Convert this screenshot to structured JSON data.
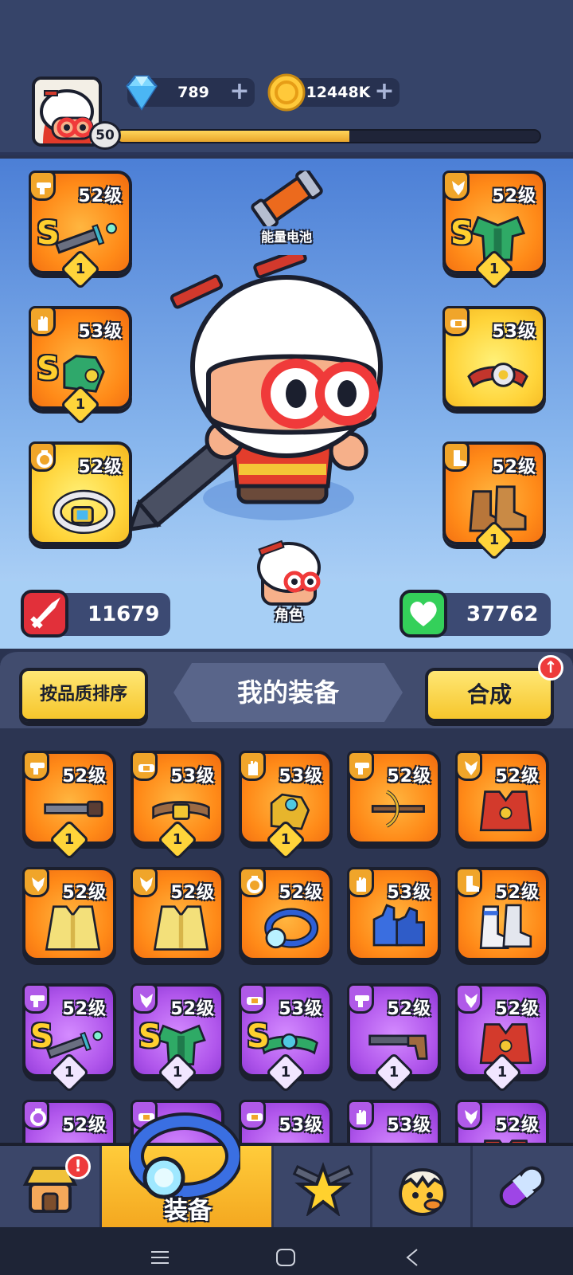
{
  "header": {
    "player_level": "50",
    "xp_progress": 0.55,
    "gems": "789",
    "coins": "12448K",
    "plus": "+"
  },
  "hero": {
    "energy_battery_label": "能量电池",
    "character_label": "角色",
    "attack": "11679",
    "health": "37762"
  },
  "equipped": [
    {
      "slot": "weapon",
      "level": "52级",
      "rarity": "orange",
      "type_icon": "gun-icon",
      "item_icon": "dagger-icon",
      "grade": "S",
      "count": "1"
    },
    {
      "slot": "gloves",
      "level": "53级",
      "rarity": "orange",
      "type_icon": "glove-icon",
      "item_icon": "green-gauntlet-icon",
      "grade": "S",
      "count": "1"
    },
    {
      "slot": "ring",
      "level": "52级",
      "rarity": "yellow",
      "type_icon": "ring-icon",
      "item_icon": "blue-gem-ring-icon",
      "grade": "",
      "count": ""
    },
    {
      "slot": "armor",
      "level": "52级",
      "rarity": "orange",
      "type_icon": "tie-icon",
      "item_icon": "green-armor-icon",
      "grade": "S",
      "count": "1"
    },
    {
      "slot": "belt",
      "level": "53级",
      "rarity": "yellow",
      "type_icon": "belt-icon",
      "item_icon": "eye-belt-icon",
      "grade": "",
      "count": ""
    },
    {
      "slot": "boots",
      "level": "52级",
      "rarity": "orange",
      "type_icon": "boot-icon",
      "item_icon": "brown-boots-icon",
      "grade": "",
      "count": "1"
    }
  ],
  "panel": {
    "sort_button": "按品质排序",
    "title": "我的装备",
    "merge_button": "合成",
    "merge_badge": "↑"
  },
  "inventory": [
    {
      "level": "52级",
      "rarity": "orange",
      "type_icon": "gun-icon",
      "item_icon": "knife-icon",
      "grade": "",
      "count": "1"
    },
    {
      "level": "53级",
      "rarity": "orange",
      "type_icon": "belt-icon",
      "item_icon": "leather-belt-icon",
      "grade": "",
      "count": "1"
    },
    {
      "level": "53级",
      "rarity": "orange",
      "type_icon": "glove-icon",
      "item_icon": "gold-gauntlet-icon",
      "grade": "",
      "count": "1"
    },
    {
      "level": "52级",
      "rarity": "orange",
      "type_icon": "gun-icon",
      "item_icon": "crossbow-icon",
      "grade": "",
      "count": ""
    },
    {
      "level": "52级",
      "rarity": "orange",
      "type_icon": "tie-icon",
      "item_icon": "red-vest-icon",
      "grade": "",
      "count": ""
    },
    {
      "level": "52级",
      "rarity": "orange",
      "type_icon": "tie-icon",
      "item_icon": "yellow-coat-icon",
      "grade": "",
      "count": ""
    },
    {
      "level": "52级",
      "rarity": "orange",
      "type_icon": "tie-icon",
      "item_icon": "yellow-coat-icon",
      "grade": "",
      "count": ""
    },
    {
      "level": "52级",
      "rarity": "orange",
      "type_icon": "ring-icon",
      "item_icon": "blue-ring-icon",
      "grade": "",
      "count": ""
    },
    {
      "level": "53级",
      "rarity": "orange",
      "type_icon": "glove-icon",
      "item_icon": "blue-gloves-icon",
      "grade": "",
      "count": ""
    },
    {
      "level": "52级",
      "rarity": "orange",
      "type_icon": "boot-icon",
      "item_icon": "white-boots-icon",
      "grade": "",
      "count": ""
    },
    {
      "level": "52级",
      "rarity": "purple",
      "type_icon": "gun-icon",
      "item_icon": "dagger-icon",
      "grade": "S",
      "count": "1"
    },
    {
      "level": "52级",
      "rarity": "purple",
      "type_icon": "tie-icon",
      "item_icon": "green-armor-icon",
      "grade": "S",
      "count": "1"
    },
    {
      "level": "53级",
      "rarity": "purple",
      "type_icon": "belt-icon",
      "item_icon": "green-belt-icon",
      "grade": "S",
      "count": "1"
    },
    {
      "level": "52级",
      "rarity": "purple",
      "type_icon": "gun-icon",
      "item_icon": "shotgun-icon",
      "grade": "",
      "count": "1"
    },
    {
      "level": "52级",
      "rarity": "purple",
      "type_icon": "tie-icon",
      "item_icon": "red-vest-icon",
      "grade": "",
      "count": "1"
    },
    {
      "level": "52级",
      "rarity": "purple",
      "type_icon": "ring-icon",
      "item_icon": "ring-icon",
      "grade": "",
      "count": ""
    },
    {
      "level": "",
      "rarity": "purple",
      "type_icon": "belt-icon",
      "item_icon": "belt-icon",
      "grade": "",
      "count": ""
    },
    {
      "level": "53级",
      "rarity": "purple",
      "type_icon": "belt-icon",
      "item_icon": "belt-icon",
      "grade": "",
      "count": ""
    },
    {
      "level": "53级",
      "rarity": "purple",
      "type_icon": "glove-icon",
      "item_icon": "gloves-icon",
      "grade": "",
      "count": ""
    },
    {
      "level": "52级",
      "rarity": "purple",
      "type_icon": "tie-icon",
      "item_icon": "vest-icon",
      "grade": "",
      "count": ""
    }
  ],
  "nav": {
    "shop_badge": "!",
    "equipment_label": "装备",
    "items": [
      "shop-icon",
      "equipment-icon",
      "weapons-star-icon",
      "pet-egg-icon",
      "capsule-icon"
    ]
  },
  "colors": {
    "orange": "#ff8a18",
    "yellow": "#ffd43a",
    "purple": "#b157ec",
    "accent": "#f6c62c",
    "hp_green": "#34d05a",
    "atk_red": "#e2303a"
  }
}
